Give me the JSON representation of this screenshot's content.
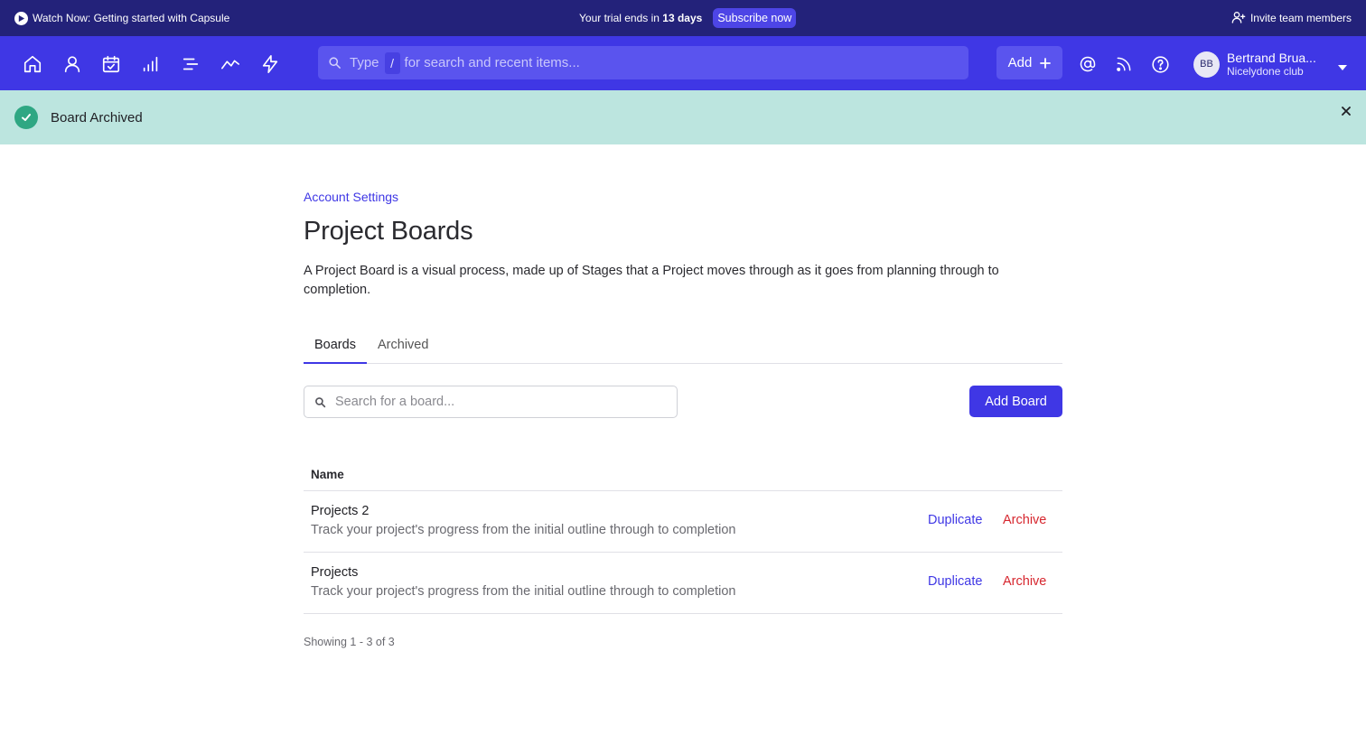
{
  "topbar": {
    "watch_label": "Watch Now: Getting started with Capsule",
    "trial_prefix": "Your trial ends in",
    "trial_days": "13 days",
    "subscribe_label": "Subscribe now",
    "invite_label": "Invite team members"
  },
  "navbar": {
    "icons": [
      "home-icon",
      "person-icon",
      "calendar-check-icon",
      "bar-chart-icon",
      "projects-icon",
      "trend-icon",
      "bolt-icon"
    ],
    "search_type": "Type",
    "search_slash": "/",
    "search_rest": "for search and recent items...",
    "add_label": "Add",
    "user_initials": "BB",
    "user_name": "Bertrand Brua...",
    "user_org": "Nicelydone club"
  },
  "flash": {
    "message": "Board Archived",
    "accent": "#2fa783",
    "background": "#bce5df"
  },
  "page": {
    "breadcrumb": "Account Settings",
    "title": "Project Boards",
    "description": "A Project Board is a visual process, made up of Stages that a Project moves through as it goes from planning through to completion.",
    "tabs": [
      {
        "label": "Boards",
        "active": true
      },
      {
        "label": "Archived",
        "active": false
      }
    ],
    "search_placeholder": "Search for a board...",
    "add_board_label": "Add Board",
    "table": {
      "column_name": "Name",
      "rows": [
        {
          "name": "Projects 2",
          "description": "Track your project's progress from the initial outline through to completion",
          "duplicate": "Duplicate",
          "archive": "Archive"
        },
        {
          "name": "Projects",
          "description": "Track your project's progress from the initial outline through to completion",
          "duplicate": "Duplicate",
          "archive": "Archive"
        }
      ]
    },
    "showing": "Showing 1 - 3 of 3"
  },
  "colors": {
    "topbar": "#23227a",
    "navbar": "#3f37e5",
    "primary": "#3f37e5",
    "danger": "#d6262e"
  }
}
